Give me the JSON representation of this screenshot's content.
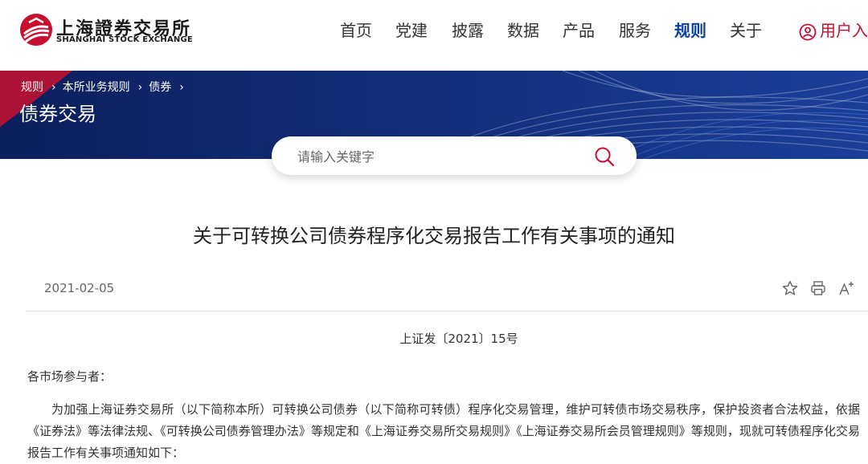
{
  "header": {
    "logo": {
      "name_cn": "上海證券交易所",
      "name_en": "SHANGHAI STOCK EXCHANGE"
    },
    "nav": [
      {
        "label": "首页",
        "active": false
      },
      {
        "label": "党建",
        "active": false
      },
      {
        "label": "披露",
        "active": false
      },
      {
        "label": "数据",
        "active": false
      },
      {
        "label": "产品",
        "active": false
      },
      {
        "label": "服务",
        "active": false
      },
      {
        "label": "规则",
        "active": true
      },
      {
        "label": "关于",
        "active": false
      }
    ],
    "user_label": "用户入",
    "active_color": "#0a3ea0",
    "brand_red": "#c8102e"
  },
  "banner": {
    "breadcrumb": [
      "规则",
      "本所业务规则",
      "债券"
    ],
    "title": "债券交易",
    "background": "#0b1f5c"
  },
  "search": {
    "placeholder": "请输入关键字",
    "icon": "search-icon"
  },
  "article": {
    "title": "关于可转换公司债券程序化交易报告工作有关事项的通知",
    "date": "2021-02-05",
    "tools": [
      "star-icon",
      "print-icon",
      "font-size-icon"
    ],
    "doc_number": "上证发〔2021〕15号",
    "salutation": "各市场参与者：",
    "paragraph": "为加强上海证券交易所（以下简称本所）可转换公司债券（以下简称可转债）程序化交易管理，维护可转债市场交易秩序，保护投资者合法权益，依据《证券法》等法律法规、《可转换公司债券管理办法》等规定和《上海证券交易所交易规则》《上海证券交易所会员管理规则》等规则，现就可转债程序化交易报告工作有关事项通知如下："
  }
}
